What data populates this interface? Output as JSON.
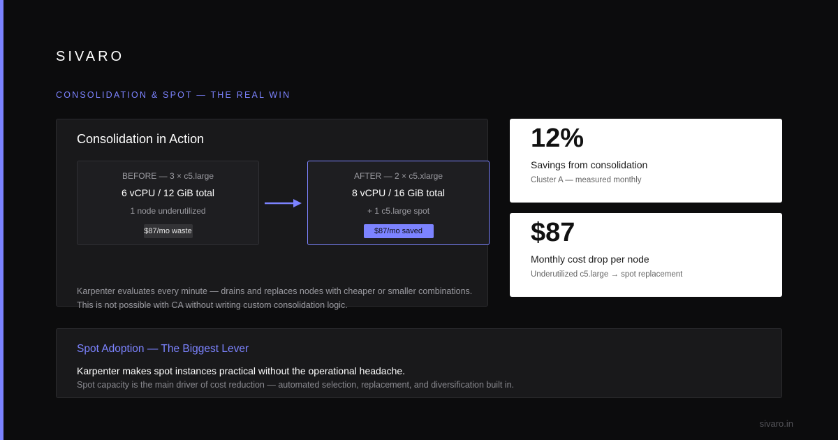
{
  "brand": "SIVARO",
  "eyebrow": "CONSOLIDATION & SPOT — THE REAL WIN",
  "consolidation": {
    "title": "Consolidation in Action",
    "before": {
      "label": "BEFORE — 3 × c5.large",
      "main": "6 vCPU / 12 GiB total",
      "sub": "1 node underutilized",
      "pill": "$87/mo waste"
    },
    "after": {
      "label": "AFTER — 2 × c5.xlarge",
      "main": "8 vCPU / 16 GiB total",
      "sub": "+ 1 c5.large spot",
      "pill": "$87/mo saved"
    },
    "note_line1": "Karpenter evaluates every minute — drains and replaces nodes with cheaper or smaller combinations.",
    "note_line2": "This is not possible with CA without writing custom consolidation logic."
  },
  "stats": [
    {
      "value": "12%",
      "label": "Savings from consolidation",
      "sub": "Cluster A — measured monthly"
    },
    {
      "value": "$87",
      "label": "Monthly cost drop per node",
      "sub": "Underutilized c5.large → spot replacement"
    }
  ],
  "spot": {
    "title": "Spot Adoption — The Biggest Lever",
    "line": "Karpenter makes spot instances practical without the operational headache.",
    "sub": "Spot capacity is the main driver of cost reduction — automated selection, replacement, and diversification built in."
  },
  "footer": "sivaro.in",
  "colors": {
    "accent": "#7c83ff",
    "background": "#0c0c0d",
    "panel": "#19191b",
    "card": "#ffffff"
  },
  "icons": {
    "transition": "arrow-right-icon"
  }
}
